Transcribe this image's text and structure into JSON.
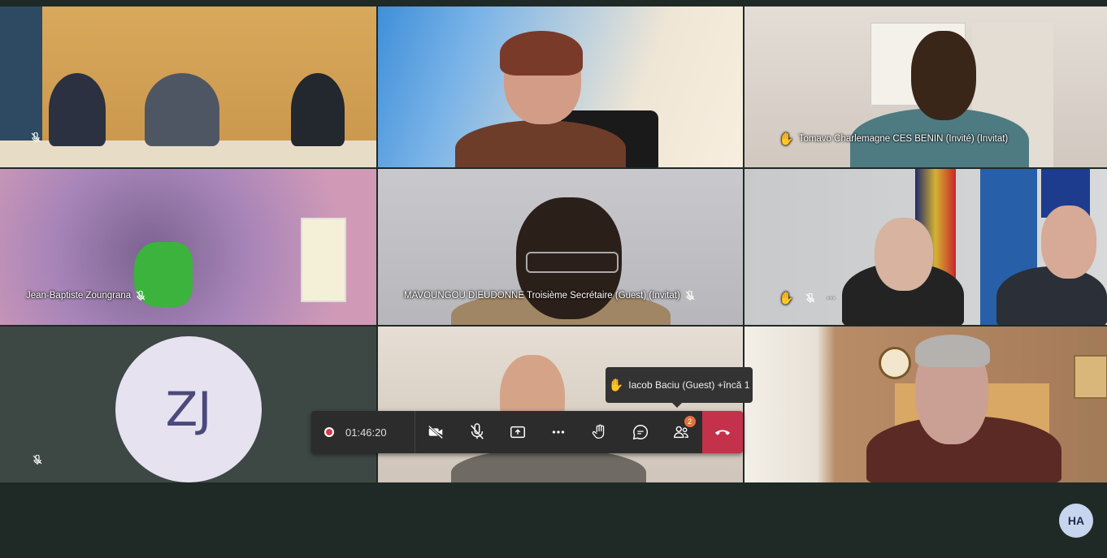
{
  "tiles": {
    "t3_label": "Tomavo Charlemagne CES BENIN (Invité) (Invitat)",
    "t4_label": "Jean-Baptiste Zoungrana",
    "t5_label": "MAVOUNGOU DIEUDONNE Troisième Secrétaire (Guest) (Invitat)",
    "t6_more": "···",
    "t7_initials": "ZJ"
  },
  "toolbar": {
    "timer": "01:46:20",
    "participants_badge": "2"
  },
  "tooltip": {
    "text": "Iacob Baciu (Guest) +încă 1"
  },
  "me": {
    "initials": "HA"
  },
  "icons": [
    "mic-off-icon",
    "raised-hand-icon",
    "camera-off-icon",
    "share-icon",
    "more-icon",
    "chat-icon",
    "participants-icon",
    "hangup-icon"
  ],
  "colors": {
    "hangup": "#c4314b",
    "recording": "#d33c4b",
    "badge": "#e0723e",
    "avatar": "#e6e2f0"
  }
}
